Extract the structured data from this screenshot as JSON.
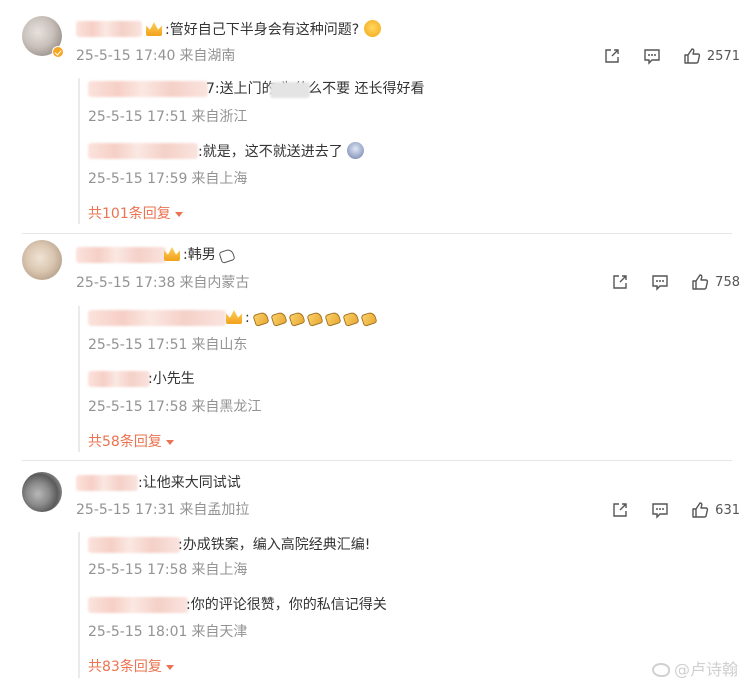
{
  "comments": [
    {
      "text": ":管好自己下半身会有这种问题?",
      "time": "25-5-15 17:40",
      "location": "来自湖南",
      "likes": "2571",
      "replies": [
        {
          "text": "7:送上门的      为什么不要   还长得好看",
          "time": "25-5-15 17:51",
          "location": "来自浙江"
        },
        {
          "text": ":就是，这不就送进去了",
          "time": "25-5-15 17:59",
          "location": "来自上海"
        }
      ],
      "more": "共101条回复"
    },
    {
      "text": ":韩男",
      "time": "25-5-15 17:38",
      "location": "来自内蒙古",
      "likes": "758",
      "replies": [
        {
          "text": ":",
          "time": "25-5-15 17:51",
          "location": "来自山东"
        },
        {
          "text": ":小先生",
          "time": "25-5-15 17:58",
          "location": "来自黑龙江"
        }
      ],
      "more": "共58条回复"
    },
    {
      "text": ":让他来大同试试",
      "time": "25-5-15 17:31",
      "location": "来自孟加拉",
      "likes": "631",
      "replies": [
        {
          "text": ":办成铁案，编入高院经典汇编!",
          "time": "25-5-15 17:58",
          "location": "来自上海"
        },
        {
          "text": ":你的评论很赞，你的私信记得关",
          "time": "25-5-15 18:01",
          "location": "来自天津"
        }
      ],
      "more": "共83条回复"
    }
  ],
  "icons": {
    "share": "share-icon",
    "comment": "comment-icon",
    "like": "thumbs-up-icon"
  },
  "watermark": "@卢诗翰",
  "colors": {
    "more_link": "#eb7350",
    "meta": "#939393"
  }
}
